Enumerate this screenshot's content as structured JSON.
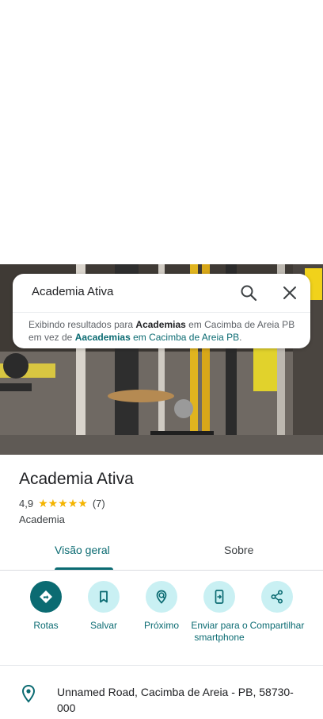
{
  "search": {
    "query": "Academia Ativa",
    "suggestion": {
      "prefix": "Exibindo resultados para ",
      "corrected_term": "Academias",
      "corrected_location": " em Cacimba de Areia PB em vez de ",
      "original_term": "Aacademias",
      "original_location": " em Cacimba de Areia PB",
      "suffix": "."
    },
    "search_icon": "search-icon",
    "close_icon": "close-icon"
  },
  "place": {
    "name": "Academia Ativa",
    "rating": "4,9",
    "stars": "★★★★★",
    "review_count": "(7)",
    "category": "Academia"
  },
  "tabs": [
    {
      "label": "Visão geral",
      "active": true
    },
    {
      "label": "Sobre",
      "active": false
    }
  ],
  "actions": [
    {
      "label": "Rotas",
      "icon": "directions-icon"
    },
    {
      "label": "Salvar",
      "icon": "bookmark-icon"
    },
    {
      "label": "Próximo",
      "icon": "nearby-icon"
    },
    {
      "label": "Enviar para o smartphone",
      "icon": "send-to-phone-icon"
    },
    {
      "label": "Compartilhar",
      "icon": "share-icon"
    }
  ],
  "address": {
    "text": "Unnamed Road, Cacimba de Areia - PB, 58730-000",
    "icon": "location-pin-icon"
  },
  "colors": {
    "accent": "#0b6b72",
    "action_bg": "#c9f0f3",
    "star": "#f4b400"
  }
}
